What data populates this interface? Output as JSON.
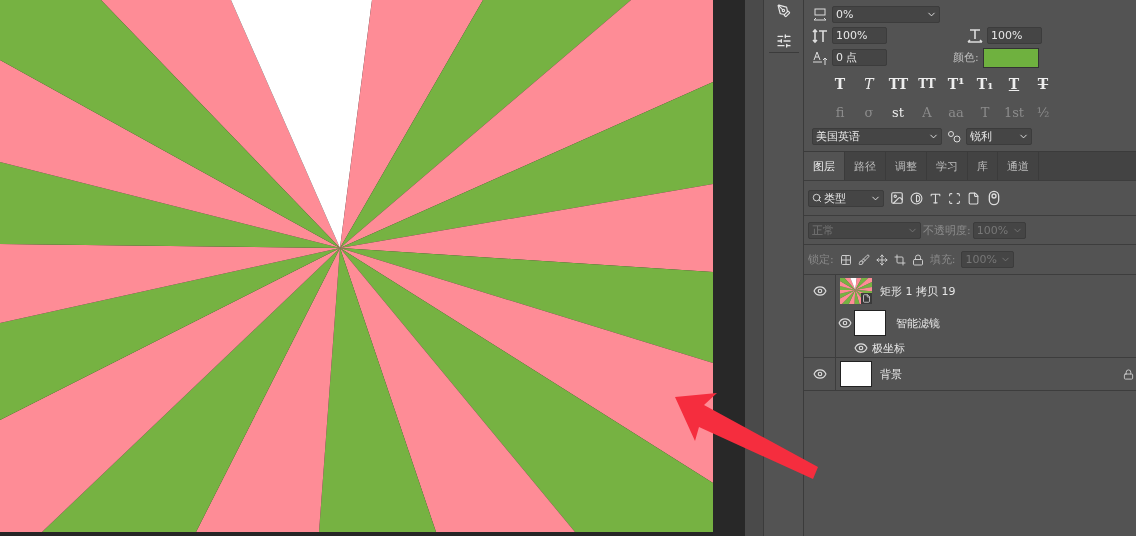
{
  "character_panel": {
    "tracking": {
      "value": "0%"
    },
    "vertical_scale": {
      "value": "100%"
    },
    "horizontal_scale": {
      "value": "100%"
    },
    "baseline_shift": {
      "value": "0 点"
    },
    "color_label": "颜色:",
    "style_buttons": [
      {
        "label": "T",
        "kind": "bold"
      },
      {
        "label": "T",
        "kind": "italic"
      },
      {
        "label": "TT",
        "kind": "allcaps"
      },
      {
        "label": "TT",
        "kind": "smallcaps"
      },
      {
        "label": "T¹",
        "kind": "superscript"
      },
      {
        "label": "T₁",
        "kind": "subscript"
      },
      {
        "label": "T",
        "kind": "underline"
      },
      {
        "label": "T",
        "kind": "strikethrough"
      }
    ],
    "opentype_buttons": [
      {
        "label": "fi",
        "disabled": true
      },
      {
        "label": "σ",
        "disabled": true
      },
      {
        "label": "st",
        "disabled": false
      },
      {
        "label": "A",
        "disabled": true
      },
      {
        "label": "aa",
        "disabled": true
      },
      {
        "label": "T",
        "disabled": true
      },
      {
        "label": "1st",
        "disabled": true
      },
      {
        "label": "½",
        "disabled": true
      }
    ],
    "language": {
      "value": "美国英语"
    },
    "antialias": {
      "value": "锐利"
    }
  },
  "layers_panel": {
    "tabs": [
      {
        "label": "图层",
        "selected": true
      },
      {
        "label": "路径",
        "selected": false
      },
      {
        "label": "调整",
        "selected": false
      },
      {
        "label": "学习",
        "selected": false
      },
      {
        "label": "库",
        "selected": false
      },
      {
        "label": "通道",
        "selected": false
      }
    ],
    "filter": {
      "value": "类型"
    },
    "blend_mode": {
      "value": "正常",
      "disabled": true
    },
    "opacity": {
      "label": "不透明度:",
      "value": "100%",
      "disabled": true
    },
    "lock_label": "锁定:",
    "fill": {
      "label": "填充:",
      "value": "100%",
      "disabled": true
    },
    "layers": [
      {
        "name": "矩形 1 拷贝 19",
        "kind": "smart-object",
        "visible": true,
        "children": [
          {
            "name": "智能滤镜",
            "kind": "smart-filters",
            "visible": true,
            "children": [
              {
                "name": "极坐标",
                "kind": "filter",
                "visible": true
              }
            ]
          }
        ]
      },
      {
        "name": "背景",
        "kind": "background",
        "visible": true
      }
    ]
  }
}
